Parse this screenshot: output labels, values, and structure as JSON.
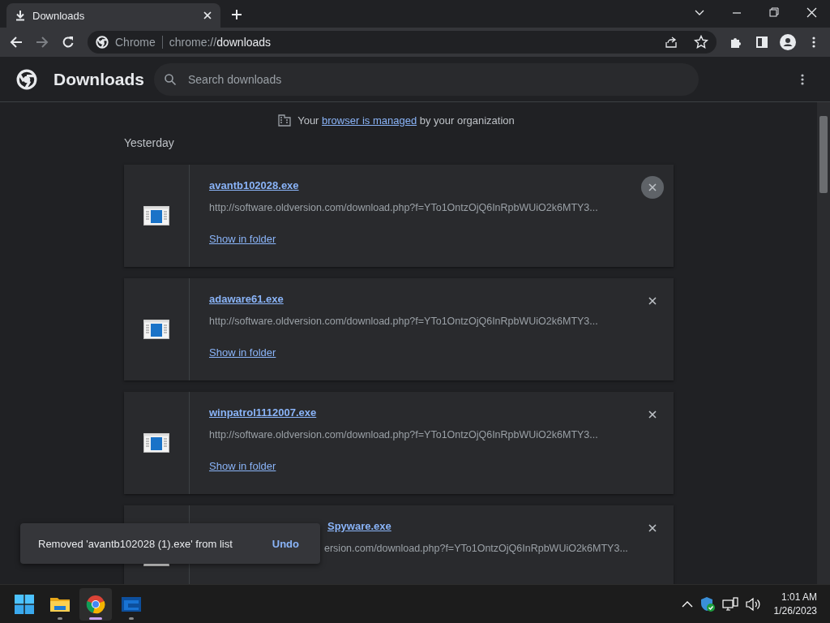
{
  "tab": {
    "title": "Downloads"
  },
  "omnibox": {
    "site": "Chrome",
    "scheme": "chrome://",
    "host": "downloads"
  },
  "header": {
    "title": "Downloads",
    "search_placeholder": "Search downloads"
  },
  "managed_notice": {
    "before": "Your ",
    "link": "browser is managed",
    "after": " by your organization"
  },
  "section": "Yesterday",
  "downloads": [
    {
      "kind": "full",
      "name": "avantb102028.exe",
      "url": "http://software.oldversion.com/download.php?f=YTo1OntzOjQ6InRpbWUiO2k6MTY3...",
      "action": "Show in folder",
      "hovered": true
    },
    {
      "kind": "full",
      "name": "adaware61.exe",
      "url": "http://software.oldversion.com/download.php?f=YTo1OntzOjQ6InRpbWUiO2k6MTY3...",
      "action": "Show in folder",
      "hovered": false
    },
    {
      "kind": "full",
      "name": "winpatrol1112007.exe",
      "url": "http://software.oldversion.com/download.php?f=YTo1OntzOjQ6InRpbWUiO2k6MTY3...",
      "action": "Show in folder",
      "hovered": false
    },
    {
      "kind": "partial",
      "name": "Spyware.exe",
      "url": "ersion.com/download.php?f=YTo1OntzOjQ6InRpbWUiO2k6MTY3...",
      "hovered": false
    }
  ],
  "toast": {
    "message": "Removed 'avantb102028 (1).exe' from list",
    "action": "Undo"
  },
  "taskbar": {
    "apps": [
      {
        "kind": "start",
        "selected": false
      },
      {
        "kind": "folder",
        "selected": false
      },
      {
        "kind": "chrome",
        "selected": true
      },
      {
        "kind": "app",
        "selected": false
      }
    ],
    "time": "1:01 AM",
    "date": "1/26/2023"
  }
}
